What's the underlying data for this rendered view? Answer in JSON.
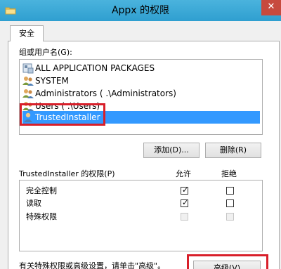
{
  "window": {
    "title": "Appx 的权限",
    "close_label": "✕",
    "title_bar_color": "#3aa8d8",
    "selection_color": "#3399ff",
    "highlight_color": "#d81f2a"
  },
  "tabs": [
    {
      "label": "安全",
      "selected": true
    }
  ],
  "group": {
    "label": "组或用户名(G):",
    "items": [
      {
        "label": "ALL APPLICATION PACKAGES",
        "icon": "app-packages-icon",
        "selected": false
      },
      {
        "label": "SYSTEM",
        "icon": "users-group-icon",
        "selected": false
      },
      {
        "label": "Administrators (       .\\Administrators)",
        "icon": "users-group-icon",
        "selected": false
      },
      {
        "label": "Users (       .\\Users)",
        "icon": "users-group-icon",
        "selected": false
      },
      {
        "label": "TrustedInstaller",
        "icon": "user-icon",
        "selected": true
      }
    ]
  },
  "buttons": {
    "add": "添加(D)...",
    "remove": "删除(R)",
    "advanced": "高级(V)"
  },
  "permissions": {
    "header": "TrustedInstaller 的权限(P)",
    "allow_header": "允许",
    "deny_header": "拒绝",
    "rows": [
      {
        "name": "完全控制",
        "allow": true,
        "deny": false,
        "enabled": true
      },
      {
        "name": "读取",
        "allow": true,
        "deny": false,
        "enabled": true
      },
      {
        "name": "特殊权限",
        "allow": false,
        "deny": false,
        "enabled": false
      }
    ]
  },
  "footer": {
    "note": "有关特殊权限或高级设置，请单击\"高级\"。"
  }
}
